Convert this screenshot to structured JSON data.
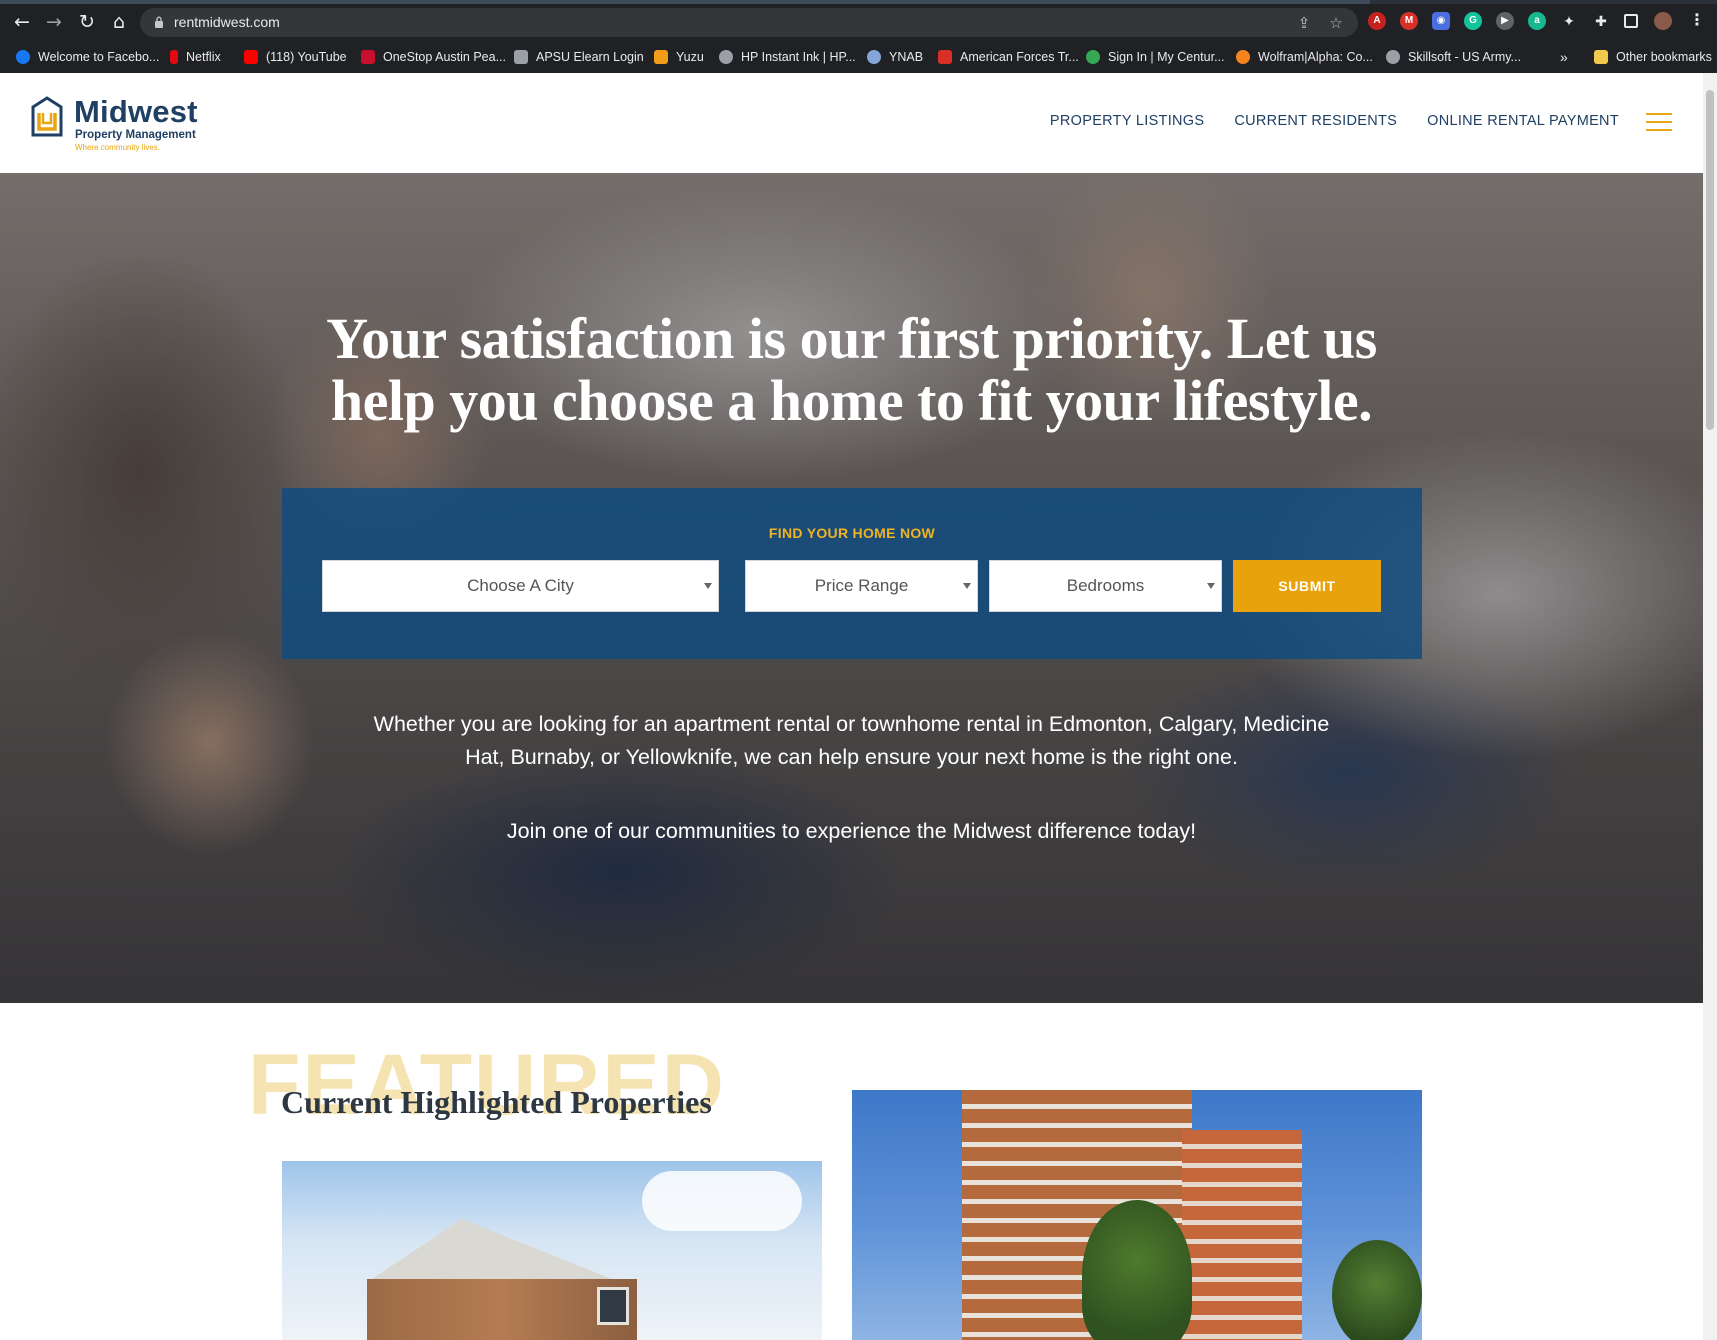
{
  "browser": {
    "url": "rentmidwest.com",
    "bookmarks": [
      {
        "label": "Welcome to Facebo...",
        "color": "#1877f2"
      },
      {
        "label": "Netflix",
        "color": "#e50914"
      },
      {
        "label": "(118) YouTube",
        "color": "#ff0000"
      },
      {
        "label": "OneStop Austin Pea...",
        "color": "#c8102e"
      },
      {
        "label": "APSU Elearn Login",
        "color": "#9aa0a6"
      },
      {
        "label": "Yuzu",
        "color": "#f29d1a"
      },
      {
        "label": "HP Instant Ink | HP...",
        "color": "#9aa0a6"
      },
      {
        "label": "YNAB",
        "color": "#85a5d6"
      },
      {
        "label": "American Forces Tr...",
        "color": "#d93025"
      },
      {
        "label": "Sign In | My Centur...",
        "color": "#34a853"
      },
      {
        "label": "Wolfram|Alpha: Co...",
        "color": "#f5841f"
      },
      {
        "label": "Skillsoft - US Army...",
        "color": "#9aa0a6"
      }
    ],
    "other_bookmarks": "Other bookmarks"
  },
  "header": {
    "logo_word": "Midwest",
    "logo_sub": "Property Management",
    "logo_tag": "Where community lives.",
    "nav": [
      "PROPERTY LISTINGS",
      "CURRENT RESIDENTS",
      "ONLINE RENTAL PAYMENT"
    ]
  },
  "hero": {
    "title_line1": "Your satisfaction is our first priority. Let us",
    "title_line2": "help you choose a home to fit your lifestyle.",
    "search_heading": "FIND YOUR HOME NOW",
    "city_select": "Choose A City",
    "price_select": "Price Range",
    "bedrooms_select": "Bedrooms",
    "submit_label": "SUBMIT",
    "paragraph": "Whether you are looking for an apartment rental or townhome rental in Edmonton, Calgary, Medicine Hat, Burnaby, or Yellowknife, we can help ensure your next home is the right one.",
    "paragraph2": "Join one of our communities to experience the Midwest difference today!"
  },
  "featured": {
    "bg_word": "FEATURED",
    "heading": "Current Highlighted Properties"
  },
  "colors": {
    "brand_navy": "#1f3f63",
    "brand_gold": "#e8a30c",
    "panel_blue": "#0e4c80"
  }
}
